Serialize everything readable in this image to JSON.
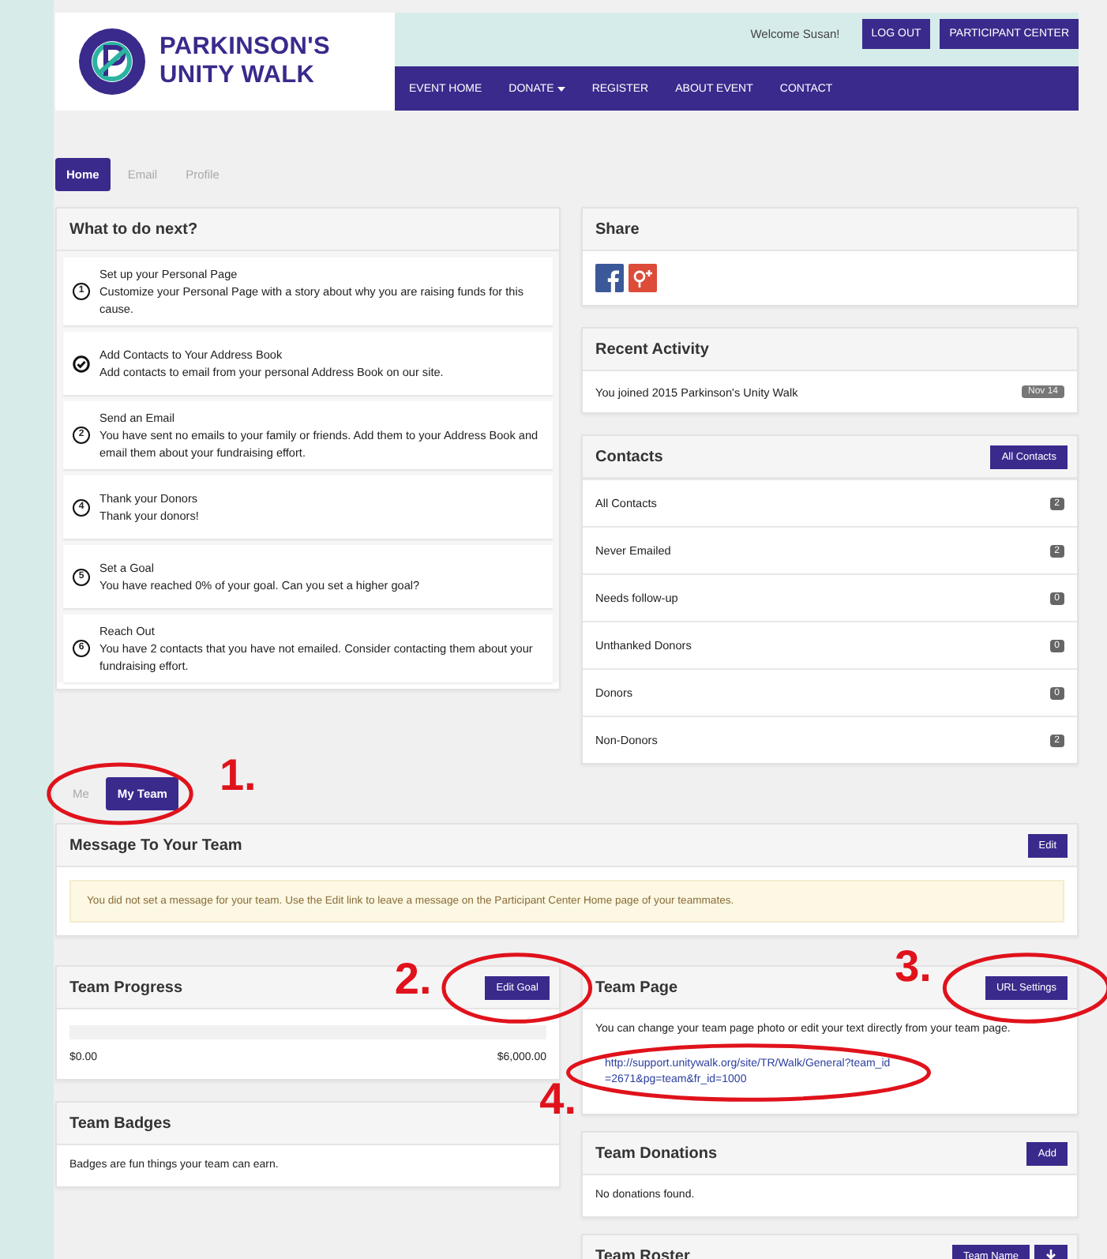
{
  "header": {
    "logo_title": "PARKINSON'S",
    "logo_subtitle": "UNITY WALK",
    "welcome": "Welcome Susan!",
    "buttons": [
      "LOG OUT",
      "PARTICIPANT CENTER"
    ],
    "nav": [
      {
        "label": "EVENT HOME",
        "dropdown": false
      },
      {
        "label": "DONATE",
        "dropdown": true
      },
      {
        "label": "REGISTER",
        "dropdown": false
      },
      {
        "label": "ABOUT EVENT",
        "dropdown": false
      },
      {
        "label": "CONTACT",
        "dropdown": false
      }
    ]
  },
  "tabs": [
    {
      "label": "Home",
      "selected": true
    },
    {
      "label": "Email",
      "selected": false
    },
    {
      "label": "Profile",
      "selected": false
    }
  ],
  "todo": {
    "title": "What to do next?",
    "steps": [
      {
        "kind": "number",
        "number": "1",
        "title": "Set up your Personal Page",
        "text": "Customize your Personal Page with a story about why you are raising funds for this cause."
      },
      {
        "kind": "check",
        "title": "Add Contacts to Your Address Book",
        "text": "Add contacts to email from your personal Address Book on our site."
      },
      {
        "kind": "number",
        "number": "2",
        "title": "Send an Email",
        "text": "You have sent no emails to your family or friends. Add them to your Address Book and email them about your fundraising effort."
      },
      {
        "kind": "number",
        "number": "4",
        "title": "Thank your Donors",
        "text": "Thank your donors!"
      },
      {
        "kind": "number",
        "number": "5",
        "title": "Set a Goal",
        "text": "You have reached 0% of your goal. Can you set a higher goal?"
      },
      {
        "kind": "number",
        "number": "6",
        "title": "Reach Out",
        "text": "You have 2 contacts that you have not emailed. Consider contacting them about your fundraising effort."
      }
    ]
  },
  "share": {
    "title": "Share"
  },
  "recent_activity": {
    "title": "Recent Activity",
    "items": [
      {
        "text": "You joined 2015 Parkinson's Unity Walk",
        "date": "Nov 14"
      }
    ]
  },
  "contacts": {
    "title": "Contacts",
    "button": "All Contacts",
    "rows": [
      {
        "label": "All Contacts",
        "count": "2"
      },
      {
        "label": "Never Emailed",
        "count": "2"
      },
      {
        "label": "Needs follow-up",
        "count": "0"
      },
      {
        "label": "Unthanked Donors",
        "count": "0"
      },
      {
        "label": "Donors",
        "count": "0"
      },
      {
        "label": "Non-Donors",
        "count": "2"
      }
    ]
  },
  "team_tabs": [
    {
      "label": "Me",
      "selected": false
    },
    {
      "label": "My Team",
      "selected": true
    }
  ],
  "team_message": {
    "title": "Message To Your Team",
    "button": "Edit",
    "notice": "You did not set a message for your team. Use the Edit link to leave a message on the Participant Center Home page of your teammates."
  },
  "team_progress": {
    "title": "Team Progress",
    "button": "Edit Goal",
    "level": 0,
    "raised": "$0.00",
    "goal": "$6,000.00"
  },
  "team_badges": {
    "title": "Team Badges",
    "text": "Badges are fun things your team can earn."
  },
  "team_page": {
    "title": "Team Page",
    "button": "URL Settings",
    "text": "You can change your team page photo or edit your text directly from your team page.",
    "url": "http://support.unitywalk.org/site/TR/Walk/General?team_id=2671&pg=team&fr_id=1000"
  },
  "team_donations": {
    "title": "Team Donations",
    "button": "Add",
    "text": "No donations found."
  },
  "team_roster": {
    "title": "Team Roster",
    "button": "Team Name"
  },
  "annotations": [
    {
      "label": "1."
    },
    {
      "label": "2."
    },
    {
      "label": "3."
    },
    {
      "label": "4."
    }
  ]
}
